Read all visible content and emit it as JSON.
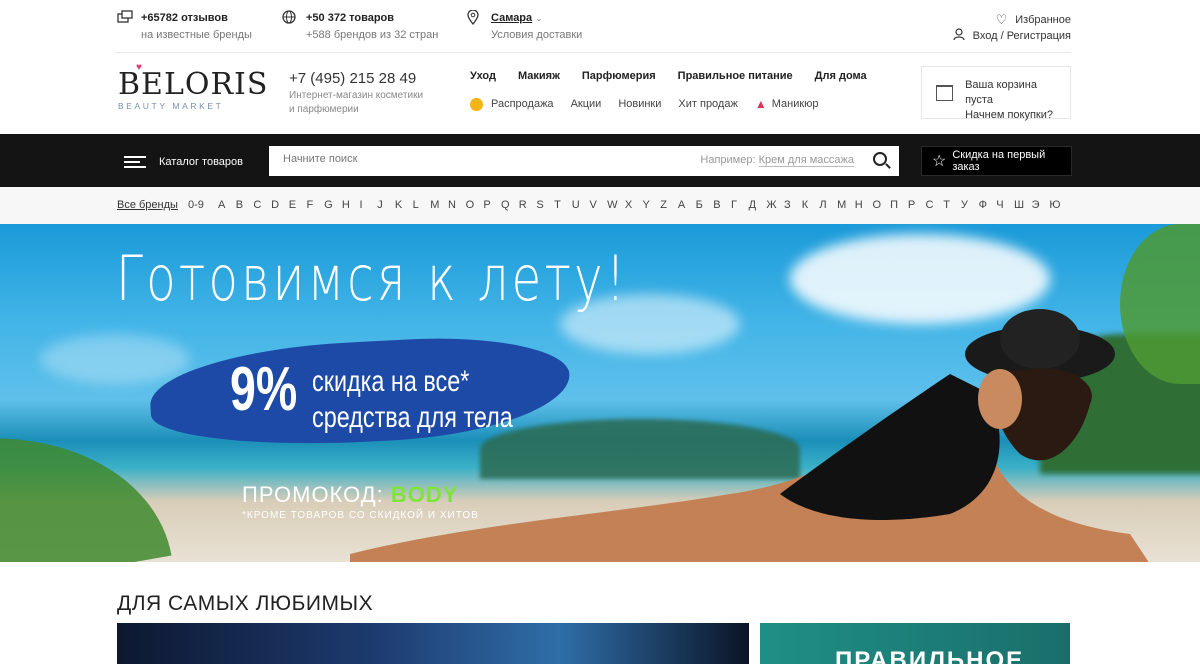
{
  "topbar": {
    "reviews_title": "+65782 отзывов",
    "reviews_sub": "на известные бренды",
    "products_title": "+50 372 товаров",
    "products_sub": "+588 брендов из 32 стран",
    "city": "Самара",
    "delivery": "Условия доставки",
    "favorites": "Избранное",
    "login": "Вход / Регистрация"
  },
  "header": {
    "logo_main": "BELORIS",
    "logo_sub": "BEAUTY MARKET",
    "phone": "+7 (495) 215 28 49",
    "phone_desc": "Интернет-магазин косметики и парфюмерии",
    "main_nav": [
      "Уход",
      "Макияж",
      "Парфюмерия",
      "Правильное питание",
      "Для дома"
    ],
    "sub_nav": [
      "Распродажа",
      "Акции",
      "Новинки",
      "Хит продаж",
      "Маникюр"
    ],
    "cart_line1": "Ваша корзина пуста",
    "cart_line2": "Начнем покупки?"
  },
  "darkbar": {
    "catalog_label": "Каталог товаров",
    "search_placeholder": "Начните поиск",
    "search_hint_prefix": "Например:",
    "search_hint_example": "Крем для массажа",
    "promo_label": "Скидка на первый заказ"
  },
  "brands": {
    "all_label": "Все бренды",
    "letters": [
      "0-9",
      "A",
      "B",
      "C",
      "D",
      "E",
      "F",
      "G",
      "H",
      "I",
      "J",
      "K",
      "L",
      "M",
      "N",
      "O",
      "P",
      "Q",
      "R",
      "S",
      "T",
      "U",
      "V",
      "W",
      "X",
      "Y",
      "Z",
      "А",
      "Б",
      "В",
      "Г",
      "Д",
      "Ж",
      "З",
      "К",
      "Л",
      "М",
      "Н",
      "О",
      "П",
      "Р",
      "С",
      "Т",
      "У",
      "Ф",
      "Ч",
      "Ш",
      "Э",
      "Ю"
    ]
  },
  "hero": {
    "headline": "Готовимся к лету!",
    "discount": "9%",
    "offer_line1": "скидка на все*",
    "offer_line2": "средства для тела",
    "promo_label": "ПРОМОКОД:",
    "promo_code": "BODY",
    "note": "*КРОМЕ ТОВАРОВ СО СКИДКОЙ И ХИТОВ"
  },
  "section": {
    "title": "ДЛЯ САМЫХ ЛЮБИМЫХ",
    "card2_title": "ПРАВИЛЬНОЕ"
  },
  "colors": {
    "accent_green": "#7fe33a",
    "brush_blue": "#1c4aa6",
    "dark_bar": "#141414",
    "sale_dot": "#f3b414"
  }
}
